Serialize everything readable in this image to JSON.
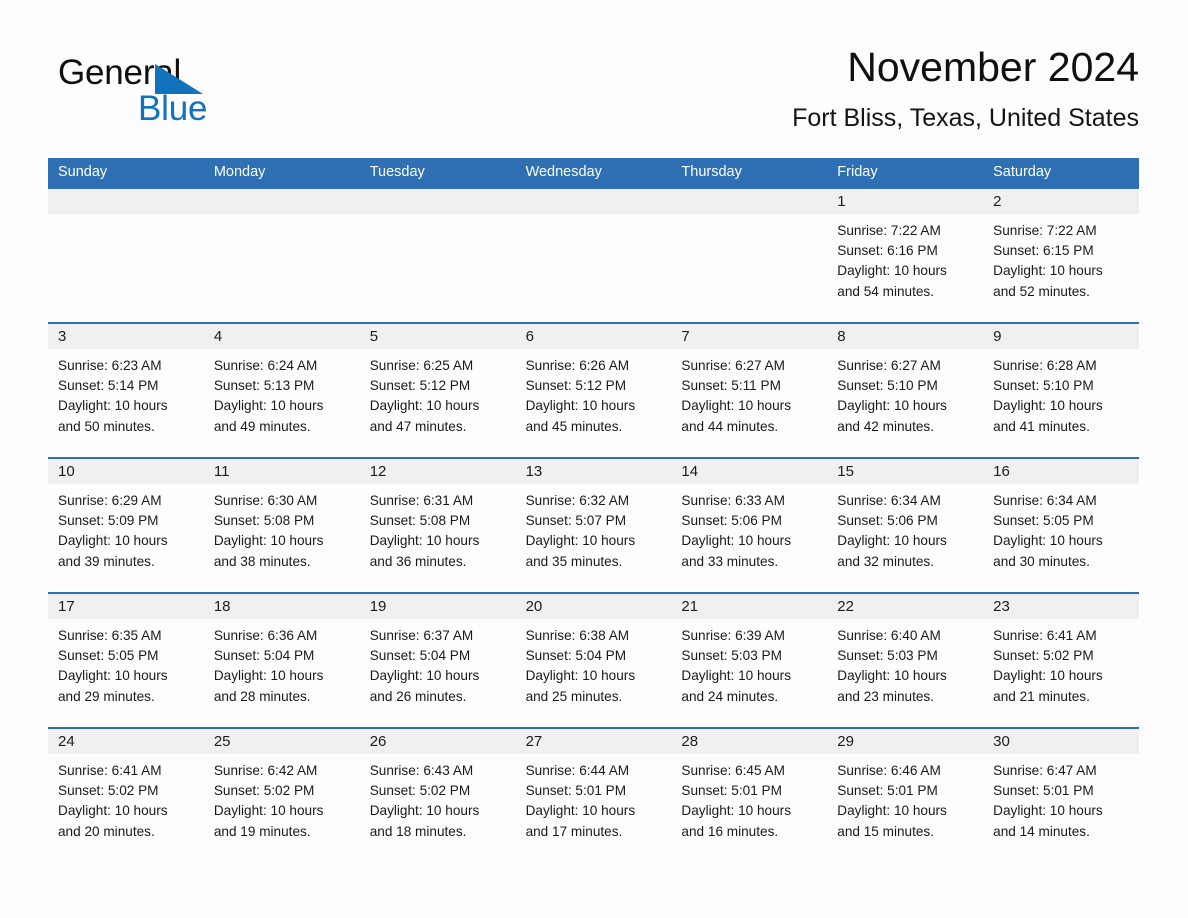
{
  "brand": {
    "name_part1": "General",
    "name_part2": "Blue",
    "logo_icon": "triangle-logo-icon",
    "accent_color": "#1272bb"
  },
  "header": {
    "title": "November 2024",
    "subtitle": "Fort Bliss, Texas, United States"
  },
  "theme": {
    "header_blue": "#2e70b3",
    "day_strip_gray": "#f0f0f0",
    "page_background": "#fdfdfd"
  },
  "weekdays": [
    "Sunday",
    "Monday",
    "Tuesday",
    "Wednesday",
    "Thursday",
    "Friday",
    "Saturday"
  ],
  "weeks": [
    [
      {
        "day": "",
        "sunrise": "",
        "sunset": "",
        "daylight_line1": "",
        "daylight_line2": ""
      },
      {
        "day": "",
        "sunrise": "",
        "sunset": "",
        "daylight_line1": "",
        "daylight_line2": ""
      },
      {
        "day": "",
        "sunrise": "",
        "sunset": "",
        "daylight_line1": "",
        "daylight_line2": ""
      },
      {
        "day": "",
        "sunrise": "",
        "sunset": "",
        "daylight_line1": "",
        "daylight_line2": ""
      },
      {
        "day": "",
        "sunrise": "",
        "sunset": "",
        "daylight_line1": "",
        "daylight_line2": ""
      },
      {
        "day": "1",
        "sunrise": "Sunrise: 7:22 AM",
        "sunset": "Sunset: 6:16 PM",
        "daylight_line1": "Daylight: 10 hours",
        "daylight_line2": "and 54 minutes."
      },
      {
        "day": "2",
        "sunrise": "Sunrise: 7:22 AM",
        "sunset": "Sunset: 6:15 PM",
        "daylight_line1": "Daylight: 10 hours",
        "daylight_line2": "and 52 minutes."
      }
    ],
    [
      {
        "day": "3",
        "sunrise": "Sunrise: 6:23 AM",
        "sunset": "Sunset: 5:14 PM",
        "daylight_line1": "Daylight: 10 hours",
        "daylight_line2": "and 50 minutes."
      },
      {
        "day": "4",
        "sunrise": "Sunrise: 6:24 AM",
        "sunset": "Sunset: 5:13 PM",
        "daylight_line1": "Daylight: 10 hours",
        "daylight_line2": "and 49 minutes."
      },
      {
        "day": "5",
        "sunrise": "Sunrise: 6:25 AM",
        "sunset": "Sunset: 5:12 PM",
        "daylight_line1": "Daylight: 10 hours",
        "daylight_line2": "and 47 minutes."
      },
      {
        "day": "6",
        "sunrise": "Sunrise: 6:26 AM",
        "sunset": "Sunset: 5:12 PM",
        "daylight_line1": "Daylight: 10 hours",
        "daylight_line2": "and 45 minutes."
      },
      {
        "day": "7",
        "sunrise": "Sunrise: 6:27 AM",
        "sunset": "Sunset: 5:11 PM",
        "daylight_line1": "Daylight: 10 hours",
        "daylight_line2": "and 44 minutes."
      },
      {
        "day": "8",
        "sunrise": "Sunrise: 6:27 AM",
        "sunset": "Sunset: 5:10 PM",
        "daylight_line1": "Daylight: 10 hours",
        "daylight_line2": "and 42 minutes."
      },
      {
        "day": "9",
        "sunrise": "Sunrise: 6:28 AM",
        "sunset": "Sunset: 5:10 PM",
        "daylight_line1": "Daylight: 10 hours",
        "daylight_line2": "and 41 minutes."
      }
    ],
    [
      {
        "day": "10",
        "sunrise": "Sunrise: 6:29 AM",
        "sunset": "Sunset: 5:09 PM",
        "daylight_line1": "Daylight: 10 hours",
        "daylight_line2": "and 39 minutes."
      },
      {
        "day": "11",
        "sunrise": "Sunrise: 6:30 AM",
        "sunset": "Sunset: 5:08 PM",
        "daylight_line1": "Daylight: 10 hours",
        "daylight_line2": "and 38 minutes."
      },
      {
        "day": "12",
        "sunrise": "Sunrise: 6:31 AM",
        "sunset": "Sunset: 5:08 PM",
        "daylight_line1": "Daylight: 10 hours",
        "daylight_line2": "and 36 minutes."
      },
      {
        "day": "13",
        "sunrise": "Sunrise: 6:32 AM",
        "sunset": "Sunset: 5:07 PM",
        "daylight_line1": "Daylight: 10 hours",
        "daylight_line2": "and 35 minutes."
      },
      {
        "day": "14",
        "sunrise": "Sunrise: 6:33 AM",
        "sunset": "Sunset: 5:06 PM",
        "daylight_line1": "Daylight: 10 hours",
        "daylight_line2": "and 33 minutes."
      },
      {
        "day": "15",
        "sunrise": "Sunrise: 6:34 AM",
        "sunset": "Sunset: 5:06 PM",
        "daylight_line1": "Daylight: 10 hours",
        "daylight_line2": "and 32 minutes."
      },
      {
        "day": "16",
        "sunrise": "Sunrise: 6:34 AM",
        "sunset": "Sunset: 5:05 PM",
        "daylight_line1": "Daylight: 10 hours",
        "daylight_line2": "and 30 minutes."
      }
    ],
    [
      {
        "day": "17",
        "sunrise": "Sunrise: 6:35 AM",
        "sunset": "Sunset: 5:05 PM",
        "daylight_line1": "Daylight: 10 hours",
        "daylight_line2": "and 29 minutes."
      },
      {
        "day": "18",
        "sunrise": "Sunrise: 6:36 AM",
        "sunset": "Sunset: 5:04 PM",
        "daylight_line1": "Daylight: 10 hours",
        "daylight_line2": "and 28 minutes."
      },
      {
        "day": "19",
        "sunrise": "Sunrise: 6:37 AM",
        "sunset": "Sunset: 5:04 PM",
        "daylight_line1": "Daylight: 10 hours",
        "daylight_line2": "and 26 minutes."
      },
      {
        "day": "20",
        "sunrise": "Sunrise: 6:38 AM",
        "sunset": "Sunset: 5:04 PM",
        "daylight_line1": "Daylight: 10 hours",
        "daylight_line2": "and 25 minutes."
      },
      {
        "day": "21",
        "sunrise": "Sunrise: 6:39 AM",
        "sunset": "Sunset: 5:03 PM",
        "daylight_line1": "Daylight: 10 hours",
        "daylight_line2": "and 24 minutes."
      },
      {
        "day": "22",
        "sunrise": "Sunrise: 6:40 AM",
        "sunset": "Sunset: 5:03 PM",
        "daylight_line1": "Daylight: 10 hours",
        "daylight_line2": "and 23 minutes."
      },
      {
        "day": "23",
        "sunrise": "Sunrise: 6:41 AM",
        "sunset": "Sunset: 5:02 PM",
        "daylight_line1": "Daylight: 10 hours",
        "daylight_line2": "and 21 minutes."
      }
    ],
    [
      {
        "day": "24",
        "sunrise": "Sunrise: 6:41 AM",
        "sunset": "Sunset: 5:02 PM",
        "daylight_line1": "Daylight: 10 hours",
        "daylight_line2": "and 20 minutes."
      },
      {
        "day": "25",
        "sunrise": "Sunrise: 6:42 AM",
        "sunset": "Sunset: 5:02 PM",
        "daylight_line1": "Daylight: 10 hours",
        "daylight_line2": "and 19 minutes."
      },
      {
        "day": "26",
        "sunrise": "Sunrise: 6:43 AM",
        "sunset": "Sunset: 5:02 PM",
        "daylight_line1": "Daylight: 10 hours",
        "daylight_line2": "and 18 minutes."
      },
      {
        "day": "27",
        "sunrise": "Sunrise: 6:44 AM",
        "sunset": "Sunset: 5:01 PM",
        "daylight_line1": "Daylight: 10 hours",
        "daylight_line2": "and 17 minutes."
      },
      {
        "day": "28",
        "sunrise": "Sunrise: 6:45 AM",
        "sunset": "Sunset: 5:01 PM",
        "daylight_line1": "Daylight: 10 hours",
        "daylight_line2": "and 16 minutes."
      },
      {
        "day": "29",
        "sunrise": "Sunrise: 6:46 AM",
        "sunset": "Sunset: 5:01 PM",
        "daylight_line1": "Daylight: 10 hours",
        "daylight_line2": "and 15 minutes."
      },
      {
        "day": "30",
        "sunrise": "Sunrise: 6:47 AM",
        "sunset": "Sunset: 5:01 PM",
        "daylight_line1": "Daylight: 10 hours",
        "daylight_line2": "and 14 minutes."
      }
    ]
  ]
}
